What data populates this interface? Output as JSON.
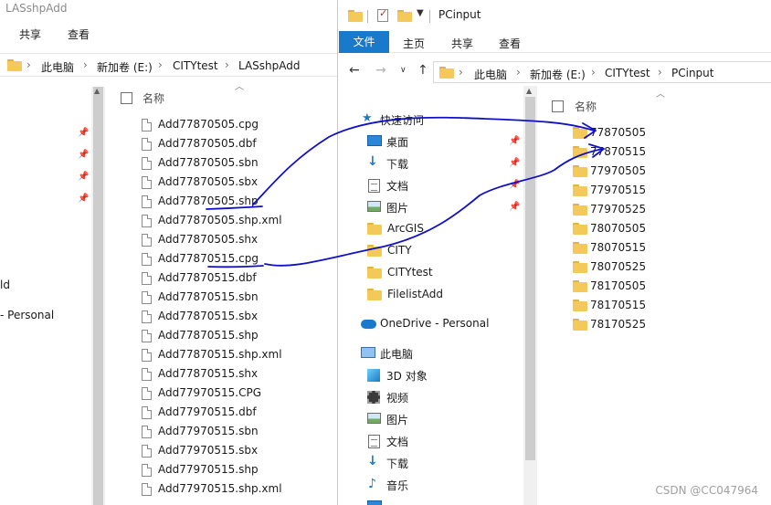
{
  "left_window": {
    "title": "LASshpAdd",
    "ribbon_tabs": [
      "共享",
      "查看"
    ],
    "breadcrumb": [
      "此电脑",
      "新加卷 (E:)",
      "CITYtest",
      "LASshpAdd"
    ],
    "partial_nav_labels": [
      "ld",
      "- Personal"
    ],
    "column_name": "名称",
    "files": [
      "Add77870505.cpg",
      "Add77870505.dbf",
      "Add77870505.sbn",
      "Add77870505.sbx",
      "Add77870505.shp",
      "Add77870505.shp.xml",
      "Add77870505.shx",
      "Add77870515.cpg",
      "Add77870515.dbf",
      "Add77870515.sbn",
      "Add77870515.sbx",
      "Add77870515.shp",
      "Add77870515.shp.xml",
      "Add77870515.shx",
      "Add77970515.CPG",
      "Add77970515.dbf",
      "Add77970515.sbn",
      "Add77970515.sbx",
      "Add77970515.shp",
      "Add77970515.shp.xml"
    ]
  },
  "right_window": {
    "title": "PCinput",
    "ribbon_tabs": {
      "file": "文件",
      "home": "主页",
      "share": "共享",
      "view": "查看"
    },
    "breadcrumb": [
      "此电脑",
      "新加卷 (E:)",
      "CITYtest",
      "PCinput"
    ],
    "nav_items": [
      {
        "label": "快速访问",
        "icon": "star-icon"
      },
      {
        "label": "桌面",
        "icon": "desktop-icon"
      },
      {
        "label": "下载",
        "icon": "download-icon"
      },
      {
        "label": "文档",
        "icon": "document-icon"
      },
      {
        "label": "图片",
        "icon": "picture-icon"
      },
      {
        "label": "ArcGIS",
        "icon": "folder-icon"
      },
      {
        "label": "CITY",
        "icon": "folder-icon"
      },
      {
        "label": "CITYtest",
        "icon": "folder-icon"
      },
      {
        "label": "FilelistAdd",
        "icon": "folder-icon"
      },
      {
        "label": "OneDrive - Personal",
        "icon": "cloud-icon"
      },
      {
        "label": "此电脑",
        "icon": "computer-icon"
      },
      {
        "label": "3D 对象",
        "icon": "3d-objects-icon"
      },
      {
        "label": "视频",
        "icon": "video-icon"
      },
      {
        "label": "图片",
        "icon": "picture-icon"
      },
      {
        "label": "文档",
        "icon": "document-icon"
      },
      {
        "label": "下载",
        "icon": "download-icon"
      },
      {
        "label": "音乐",
        "icon": "music-icon"
      }
    ],
    "column_name": "名称",
    "folders": [
      "77870505",
      "77870515",
      "77970505",
      "77970515",
      "77970525",
      "78070505",
      "78070515",
      "78070525",
      "78170505",
      "78170515",
      "78170525"
    ]
  },
  "annotation": {
    "stroke_color": "#1010c8"
  },
  "watermark": "CSDN @CC047964"
}
